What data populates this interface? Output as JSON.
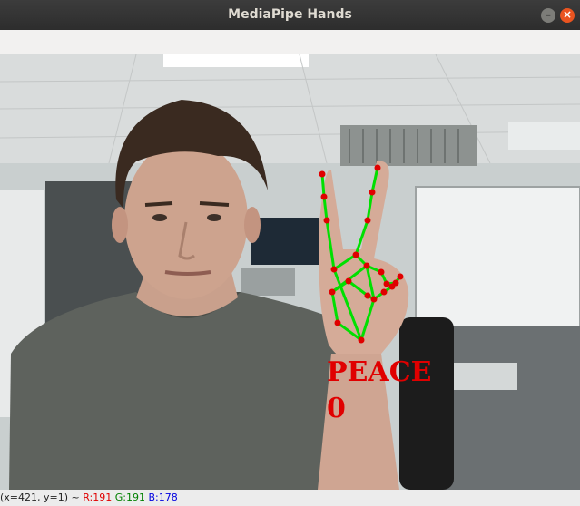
{
  "window": {
    "title": "MediaPipe Hands",
    "minimize_glyph": "–",
    "close_glyph": "×"
  },
  "overlay": {
    "gesture_label": "PEACE",
    "gesture_index": "0",
    "landmark_color": "#e00000",
    "connection_color": "#00e000"
  },
  "status": {
    "coords": "(x=421, y=1) ~ ",
    "r": "R:191",
    "g": "G:191",
    "b": "B:178",
    "r_color": "#e00000",
    "g_color": "#008000",
    "b_color": "#0000e0"
  }
}
